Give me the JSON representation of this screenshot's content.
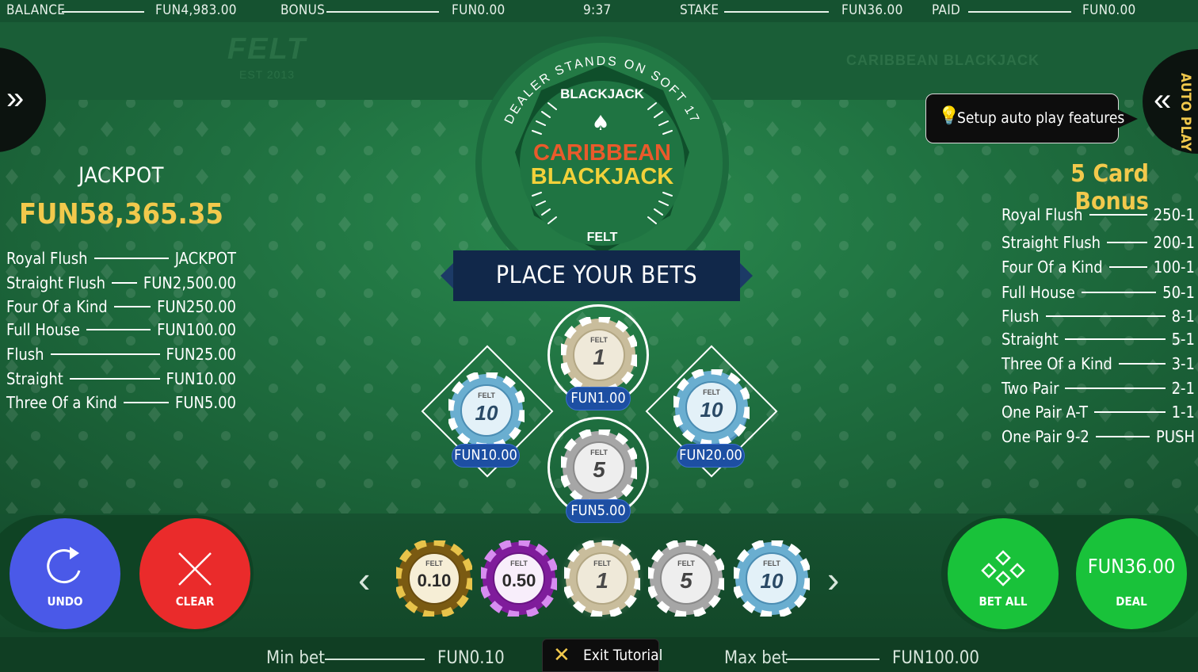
{
  "status_bar": {
    "balance_label": "BALANCE",
    "balance_value": "FUN4,983.00",
    "bonus_label": "BONUS",
    "bonus_value": "FUN0.00",
    "time": "9:37",
    "stake_label": "STAKE",
    "stake_value": "FUN36.00",
    "paid_label": "PAID",
    "paid_value": "FUN0.00"
  },
  "branding": {
    "felt_logo": "FELT",
    "felt_est": "EST 2013",
    "game_logo": "CARIBBEAN BLACKJACK"
  },
  "emblem": {
    "arc_text": "DEALER STANDS ON SOFT 17",
    "top_text": "BLACKJACK",
    "title_line1": "CARIBBEAN",
    "title_line2": "BLACKJACK",
    "bottom_text": "FELT"
  },
  "banner": {
    "text": "PLACE YOUR BETS"
  },
  "autoplay": {
    "label": "AUTO PLAY",
    "tooltip": "Setup auto play features"
  },
  "jackpot": {
    "title": "JACKPOT",
    "amount": "FUN58,365.35",
    "rows": [
      {
        "hand": "Royal Flush",
        "payout": "JACKPOT"
      },
      {
        "hand": "Straight Flush",
        "payout": "FUN2,500.00"
      },
      {
        "hand": "Four Of a Kind",
        "payout": "FUN250.00"
      },
      {
        "hand": "Full House",
        "payout": "FUN100.00"
      },
      {
        "hand": "Flush",
        "payout": "FUN25.00"
      },
      {
        "hand": "Straight",
        "payout": "FUN10.00"
      },
      {
        "hand": "Three Of a Kind",
        "payout": "FUN5.00"
      }
    ]
  },
  "five_card_bonus": {
    "title": "5 Card Bonus",
    "rows": [
      {
        "hand": "Royal Flush",
        "payout": "250-1"
      },
      {
        "hand": "Straight Flush",
        "payout": "200-1"
      },
      {
        "hand": "Four Of a Kind",
        "payout": "100-1"
      },
      {
        "hand": "Full House",
        "payout": "50-1"
      },
      {
        "hand": "Flush",
        "payout": "8-1"
      },
      {
        "hand": "Straight",
        "payout": "5-1"
      },
      {
        "hand": "Three Of a Kind",
        "payout": "3-1"
      },
      {
        "hand": "Two Pair",
        "payout": "2-1"
      },
      {
        "hand": "One Pair A-T",
        "payout": "1-1"
      },
      {
        "hand": "One Pair 9-2",
        "payout": "PUSH"
      }
    ]
  },
  "bet_spots": {
    "top": {
      "chip_value": "1",
      "amount": "FUN1.00"
    },
    "left": {
      "chip_value": "10",
      "amount": "FUN10.00"
    },
    "right": {
      "chip_value": "10",
      "amount": "FUN20.00"
    },
    "bottom": {
      "chip_value": "5",
      "amount": "FUN5.00"
    }
  },
  "chip_tray": [
    {
      "value": "0.10",
      "color": "#7a5a12"
    },
    {
      "value": "0.50",
      "color": "#7f1c9b"
    },
    {
      "value": "1",
      "color": "#c9bd9c"
    },
    {
      "value": "5",
      "color": "#a6a6a6"
    },
    {
      "value": "10",
      "color": "#6aaed0"
    }
  ],
  "chip_brand": "FELT",
  "buttons": {
    "undo": "UNDO",
    "clear": "CLEAR",
    "bet_all": "BET ALL",
    "deal_amount": "FUN36.00",
    "deal": "DEAL"
  },
  "footer": {
    "min_bet_label": "Min bet",
    "min_bet_value": "FUN0.10",
    "max_bet_label": "Max bet",
    "max_bet_value": "FUN100.00",
    "exit_tutorial": "Exit Tutorial"
  },
  "colors": {
    "felt": "#1e6a3c",
    "gold": "#f2c94c",
    "undo": "#4a59e8",
    "clear": "#ea2b2b",
    "bet_green": "#19c23a",
    "pill_blue": "#1d4fa3"
  },
  "icons": {
    "menu": "double-chevron-right-icon",
    "autoplay": "double-chevron-left-icon",
    "tooltip": "lightbulb-icon",
    "undo": "undo-arrow-icon",
    "clear": "x-icon",
    "bet_all": "diamond-cluster-icon",
    "prev": "chevron-left-icon",
    "next": "chevron-right-icon",
    "exit": "close-icon"
  }
}
